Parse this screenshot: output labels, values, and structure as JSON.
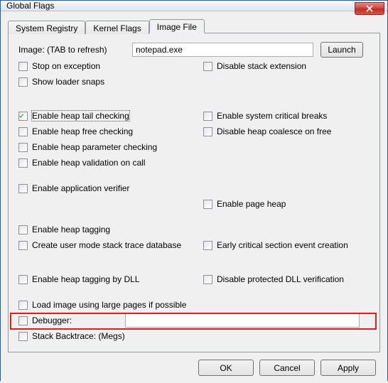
{
  "window": {
    "title": "Global Flags"
  },
  "tabs": {
    "registry": "System Registry",
    "kernel": "Kernel Flags",
    "image": "Image File",
    "active": "image"
  },
  "image": {
    "label": "Image: (TAB to refresh)",
    "value": "notepad.exe",
    "launch": "Launch"
  },
  "options": {
    "stop_on_exception": "Stop on exception",
    "show_loader_snaps": "Show loader snaps",
    "disable_stack_extension": "Disable stack extension",
    "enable_heap_tail": "Enable heap tail checking",
    "enable_heap_free": "Enable heap free checking",
    "enable_heap_param": "Enable heap parameter checking",
    "enable_heap_validation": "Enable heap validation on call",
    "enable_system_critical": "Enable system critical breaks",
    "disable_heap_coalesce": "Disable heap coalesce on free",
    "enable_app_verifier": "Enable application verifier",
    "enable_page_heap": "Enable page heap",
    "enable_heap_tagging": "Enable heap tagging",
    "create_user_mode_trace": "Create user mode stack trace database",
    "early_critical": "Early critical section event creation",
    "enable_heap_tag_dll": "Enable heap tagging by DLL",
    "disable_protected_dll": "Disable protected DLL verification",
    "load_large_pages": "Load image using large pages if possible",
    "debugger": "Debugger:",
    "stack_backtrace": "Stack Backtrace: (Megs)"
  },
  "checked": {
    "enable_heap_tail": true
  },
  "buttons": {
    "ok": "OK",
    "cancel": "Cancel",
    "apply": "Apply"
  }
}
